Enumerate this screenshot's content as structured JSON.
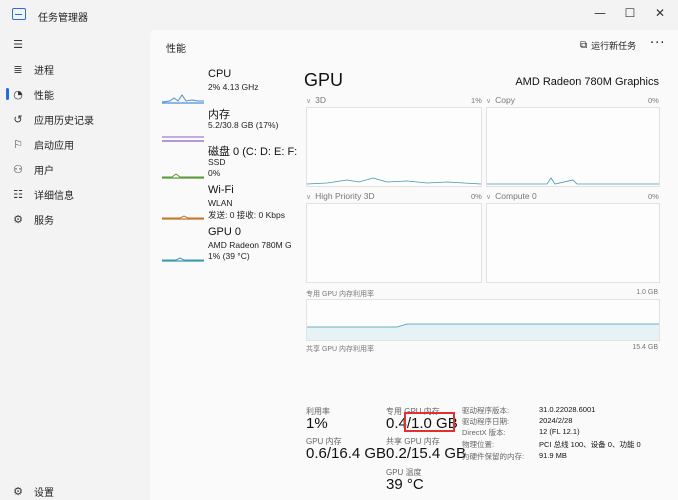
{
  "window": {
    "title": "任务管理器",
    "minimize_glyph": "—",
    "maximize_glyph": "☐",
    "close_glyph": "✕"
  },
  "nav": {
    "menu_glyph": "☰",
    "items": [
      {
        "label": "进程",
        "icon": "≣"
      },
      {
        "label": "性能",
        "icon": "◔"
      },
      {
        "label": "应用历史记录",
        "icon": "↺"
      },
      {
        "label": "启动应用",
        "icon": "⚐"
      },
      {
        "label": "用户",
        "icon": "⚇"
      },
      {
        "label": "详细信息",
        "icon": "☷"
      },
      {
        "label": "服务",
        "icon": "⚙"
      }
    ],
    "settings": {
      "label": "设置",
      "icon": "⚙"
    }
  },
  "header": {
    "title": "性能",
    "run_task": "运行新任务",
    "run_task_icon": "⧉",
    "more": "···"
  },
  "devices": [
    {
      "name": "CPU",
      "sub1": "2% 4.13 GHz",
      "sub2": "",
      "color": "#4a8fd6",
      "level": 0.02
    },
    {
      "name": "内存",
      "sub1": "5.2/30.8 GB (17%)",
      "sub2": "",
      "color": "#8a5fc0",
      "level": 0.17
    },
    {
      "name": "磁盘 0 (C: D: E: F:",
      "sub1": "SSD",
      "sub2": "0%",
      "color": "#5a9a3a",
      "level": 0.0
    },
    {
      "name": "Wi-Fi",
      "sub1": "WLAN",
      "sub2": "发送: 0 接收: 0 Kbps",
      "color": "#c0782a",
      "level": 0.0
    },
    {
      "name": "GPU 0",
      "sub1": "AMD Radeon 780M G",
      "sub2": "1% (39 °C)",
      "color": "#3a9ab0",
      "level": 0.01
    }
  ],
  "gpu": {
    "title": "GPU",
    "model": "AMD Radeon 780M Graphics",
    "engines": [
      {
        "label": "3D",
        "pct": "1%"
      },
      {
        "label": "Copy",
        "pct": "0%"
      },
      {
        "label": "High Priority 3D",
        "pct": "0%"
      },
      {
        "label": "Compute 0",
        "pct": "0%"
      }
    ],
    "dedicated_mem_label": "专用 GPU 内存利用率",
    "dedicated_mem_max": "1.0 GB",
    "shared_mem_label": "共享 GPU 内存利用率",
    "shared_mem_max": "15.4 GB",
    "stats": {
      "utilization_label": "利用率",
      "utilization": "1%",
      "dedicated_label": "专用 GPU 内存",
      "dedicated_used": "0.4",
      "dedicated_total": "/1.0 GB",
      "gpu_mem_label": "GPU 内存",
      "gpu_mem": "0.6/16.4 GB",
      "shared_label": "共享 GPU 内存",
      "shared": "0.2/15.4 GB",
      "temp_label": "GPU 温度",
      "temp": "39 °C"
    },
    "properties": [
      {
        "key": "驱动程序版本:",
        "value": "31.0.22028.6001"
      },
      {
        "key": "驱动程序日期:",
        "value": "2024/2/28"
      },
      {
        "key": "DirectX 版本:",
        "value": "12 (FL 12.1)"
      },
      {
        "key": "物理位置:",
        "value": "PCI 总线 100、设备 0、功能 0"
      },
      {
        "key": "为硬件保留的内存:",
        "value": "91.9 MB"
      }
    ]
  },
  "colors": {
    "gpu_graph": "#3a9ab0",
    "highlight": "#e03030",
    "accent": "#1f6fd6"
  }
}
